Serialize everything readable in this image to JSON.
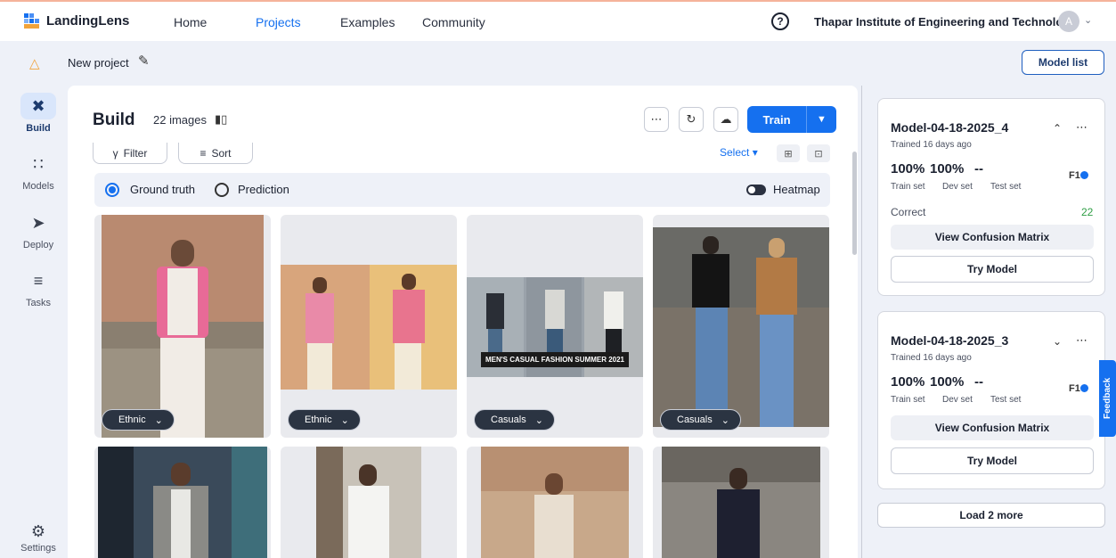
{
  "topnav": {
    "brand": "LandingLens",
    "links": [
      "Home",
      "Projects",
      "Examples",
      "Community"
    ],
    "active_link": "Projects",
    "help_glyph": "?",
    "organization": "Thapar Institute of Engineering and Technology",
    "avatar_initial": "A",
    "brand_color": "#1570ef"
  },
  "project": {
    "name": "New project",
    "model_list_label": "Model list"
  },
  "sidebar": {
    "items": [
      {
        "label": "Build",
        "icon": "tools-icon",
        "active": true
      },
      {
        "label": "Models",
        "icon": "network-icon",
        "active": false
      },
      {
        "label": "Deploy",
        "icon": "rocket-icon",
        "active": false
      },
      {
        "label": "Tasks",
        "icon": "tasks-icon",
        "active": false
      }
    ],
    "settings_label": "Settings"
  },
  "build": {
    "title": "Build",
    "image_count": "22 images",
    "train_label": "Train",
    "filter_label": "Filter",
    "sort_label": "Sort",
    "select_label": "Select",
    "view_mode": {
      "ground_truth": "Ground truth",
      "prediction": "Prediction",
      "selected": "Ground truth"
    },
    "heatmap_label": "Heatmap",
    "images": [
      {
        "tag": "Ethnic"
      },
      {
        "tag": "Ethnic"
      },
      {
        "tag": "Casuals",
        "caption": "MEN'S CASUAL FASHION SUMMER 2021"
      },
      {
        "tag": "Casuals"
      },
      {
        "tag": ""
      },
      {
        "tag": ""
      },
      {
        "tag": ""
      },
      {
        "tag": ""
      }
    ]
  },
  "models": [
    {
      "name": "Model-04-18-2025_4",
      "trained": "Trained 16 days ago",
      "expanded": true,
      "train_pct": "100%",
      "dev_pct": "100%",
      "test_pct": "--",
      "train_label": "Train set",
      "dev_label": "Dev set",
      "test_label": "Test set",
      "metric": "F1",
      "correct_label": "Correct",
      "correct_value": "22",
      "confusion_label": "View Confusion Matrix",
      "try_label": "Try Model"
    },
    {
      "name": "Model-04-18-2025_3",
      "trained": "Trained 16 days ago",
      "expanded": false,
      "train_pct": "100%",
      "dev_pct": "100%",
      "test_pct": "--",
      "train_label": "Train set",
      "dev_label": "Dev set",
      "test_label": "Test set",
      "metric": "F1",
      "confusion_label": "View Confusion Matrix",
      "try_label": "Try Model"
    }
  ],
  "load_more_label": "Load 2 more",
  "feedback_label": "Feedback"
}
